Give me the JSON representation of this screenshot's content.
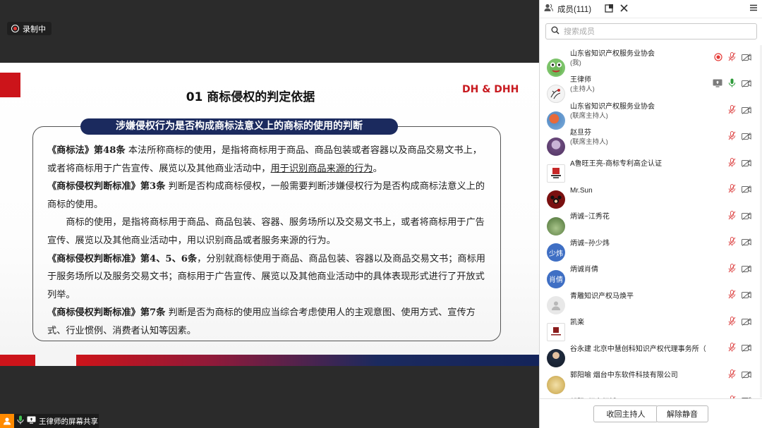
{
  "recording": {
    "label": "录制中"
  },
  "slide": {
    "title": "01  商标侵权的判定依据",
    "logo_text": "DH & DHH",
    "banner": "涉嫌侵权行为是否构成商标法意义上的商标的使用的判断",
    "para1_bold": "《商标法》第48条",
    "para1_text": "  本法所称商标的使用，是指将商标用于商品、商品包装或者容器以及商品交易文书上，或者将商标用于广告宣传、展览以及其他商业活动中，",
    "para1_underline": "用于识别商品来源的行为",
    "para1_end": "。",
    "para2_bold": "《商标侵权判断标准》第3条",
    "para2_text": "  判断是否构成商标侵权，一般需要判断涉嫌侵权行为是否构成商标法意义上的商标的使用。",
    "para3_text": "商标的使用，是指将商标用于商品、商品包装、容器、服务场所以及交易文书上，或者将商标用于广告宣传、展览以及其他商业活动中，用以识别商品或者服务来源的行为。",
    "para4_bold": "《商标侵权判断标准》第4、5、6条",
    "para4_text": "，分别就商标使用于商品、商品包装、容器以及商品交易文书；商标用于服务场所以及服务交易文书；商标用于广告宣传、展览以及其他商业活动中的具体表现形式进行了开放式列举。",
    "para5_bold": "《商标侵权判断标准》第7条",
    "para5_text": "  判断是否为商标的使用应当综合考虑使用人的主观意图、使用方式、宣传方式、行业惯例、消费者认知等因素。"
  },
  "share_tag": {
    "label": "王律师的屏幕共享"
  },
  "panel": {
    "title": "成员(111)",
    "search_placeholder": "搜索成员",
    "members": [
      {
        "name": "山东省知识产权服务业协会",
        "role": "(我)",
        "avatar": "frog",
        "rec": true
      },
      {
        "name": "王律师",
        "role": "(主持人)",
        "avatar": "sketch",
        "share": true,
        "mic_on": true
      },
      {
        "name": "山东省知识产权服务业协会",
        "role": "(联席主持人)",
        "avatar": "blue-photo"
      },
      {
        "name": "赵旦芬",
        "role": "(联席主持人)",
        "avatar": "purple-photo"
      },
      {
        "name": "A鲁旺王亮-商标专利高企认证",
        "role": "",
        "avatar": "red-logo"
      },
      {
        "name": "Mr.Sun",
        "role": "",
        "avatar": "mickey"
      },
      {
        "name": "炳诚~江秀花",
        "role": "",
        "avatar": "green-photo"
      },
      {
        "name": "炳诚~孙少炜",
        "role": "",
        "avatar": "text",
        "avatar_text": "少炜"
      },
      {
        "name": "炳诚肖倩",
        "role": "",
        "avatar": "text",
        "avatar_text": "肖倩"
      },
      {
        "name": "青雕知识产权马焕平",
        "role": "",
        "avatar": "default"
      },
      {
        "name": "凯楽",
        "role": "",
        "avatar": "logo-small"
      },
      {
        "name": "谷永建  北京中慧创科知识产权代理事务所（",
        "role": "",
        "avatar": "suit-photo"
      },
      {
        "name": "郭阳喻 烟台中东软件科技有限公司",
        "role": "",
        "avatar": "yellow-photo"
      },
      {
        "name": "郭阳~烟台恒博",
        "role": "",
        "avatar": "pink-photo"
      }
    ],
    "footer": {
      "reclaim_label": "收回主持人",
      "unmute_label": "解除静音"
    }
  },
  "colors": {
    "slide_red": "#cc141a",
    "slide_navy": "#1b2a5e",
    "mic_muted": "#e05555",
    "mic_on": "#2e9b3a",
    "avatar_blue": "#3f6fc4",
    "avatar_maroon": "#7a1010"
  }
}
